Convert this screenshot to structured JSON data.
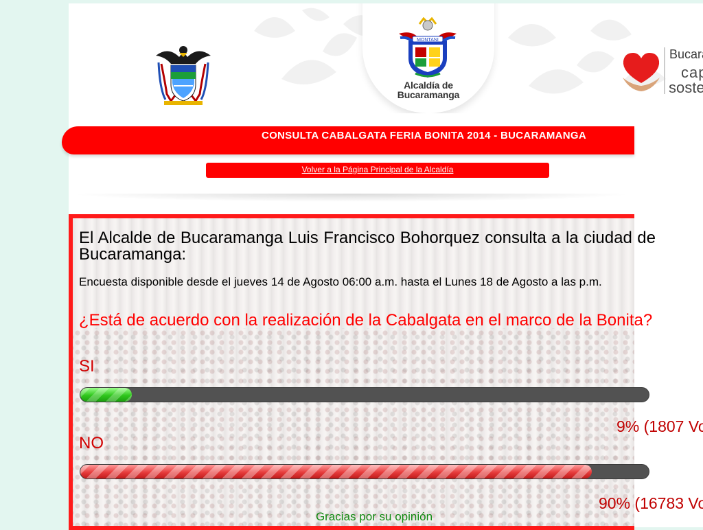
{
  "header": {
    "alcaldia_line1": "Alcaldía de",
    "alcaldia_line2": "Bucaramanga",
    "shield_banner": "MONTANI",
    "capital_line1": "Bucara",
    "capital_line2": "cap",
    "capital_line3": "soste"
  },
  "title": "CONSULTA CABALGATA FERIA BONITA 2014 - BUCARAMANGA",
  "back_link": "Volver a la Página Principal de la Alcaldía",
  "poll": {
    "intro": "El Alcalde de Bucaramanga Luis Francisco Bohorquez consulta a la ciudad de Bucaramanga:",
    "availability": "Encuesta disponible desde el jueves 14 de Agosto 06:00 a.m. hasta el Lunes 18 de Agosto a las p.m.",
    "question": "¿Está de acuerdo con la realización de la Cabalgata en el marco de la Bonita?",
    "options": [
      {
        "label": "SI",
        "result": "9% (1807 Vo",
        "fill_percent": 9
      },
      {
        "label": "NO",
        "result": "90% (16783 Vo",
        "fill_percent": 90
      }
    ],
    "thanks": "Gracias por su opinión"
  },
  "colors": {
    "accent_red": "#ff0000",
    "bar_track": "#525252",
    "yes_green": "#2fc61c",
    "no_red": "#e63c3c",
    "thanks_green": "#118a11"
  }
}
